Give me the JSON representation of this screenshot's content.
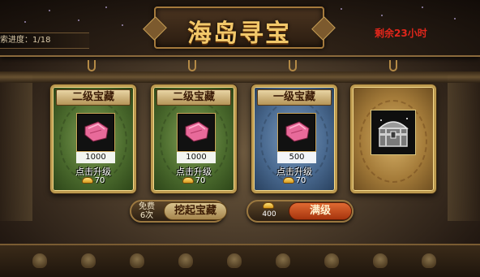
{
  "header": {
    "title": "海岛寻宝",
    "progress": "索进度：1/18",
    "remaining": "剩余23小时"
  },
  "cards": [
    {
      "title": "二级宝藏",
      "quantity": "1000",
      "action": "点击升级",
      "cost": "70",
      "theme": "green",
      "icon": "cloth-icon"
    },
    {
      "title": "二级宝藏",
      "quantity": "1000",
      "action": "点击升级",
      "cost": "70",
      "theme": "green",
      "icon": "cloth-icon"
    },
    {
      "title": "一级宝藏",
      "quantity": "500",
      "action": "点击升级",
      "cost": "70",
      "theme": "blue",
      "icon": "cloth-icon"
    },
    {
      "title": "",
      "quantity": "",
      "action": "",
      "cost": "",
      "theme": "gold",
      "icon": "treasure-chest-icon"
    }
  ],
  "actions": {
    "dig": {
      "free_line1": "免费",
      "free_line2": "6次",
      "label": "挖起宝藏"
    },
    "max": {
      "gold_cost": "400",
      "label": "满级"
    }
  },
  "colors": {
    "title_gold": "#f2c86a",
    "remaining_red": "#e0261b",
    "card_green": "#4c6c2e",
    "card_blue": "#4a6a90",
    "card_gold": "#a57c3a",
    "max_button": "#c04a1a"
  }
}
